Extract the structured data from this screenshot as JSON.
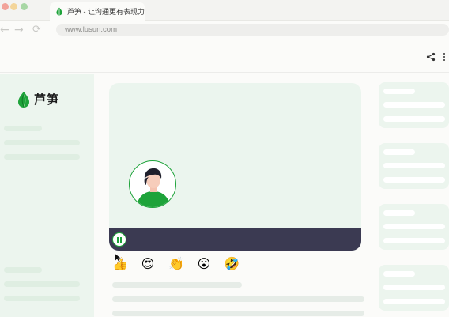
{
  "browser": {
    "tab_title": "芦笋 - 让沟通更有表现力",
    "url": "www.lusun.com",
    "nav": {
      "back": "←",
      "forward": "→",
      "reload": "⟳"
    }
  },
  "sidebar": {
    "logo_text": "芦笋"
  },
  "emojis": [
    {
      "name": "thumbs-up-emoji",
      "glyph": "👍"
    },
    {
      "name": "heart-eyes-emoji",
      "glyph": "😍"
    },
    {
      "name": "clapping-emoji",
      "glyph": "👏"
    },
    {
      "name": "surprised-emoji",
      "glyph": "😮"
    },
    {
      "name": "laughing-emoji",
      "glyph": "🤣"
    }
  ],
  "video": {
    "progress_fraction": 0.09,
    "state": "playing"
  },
  "colors": {
    "accent": "#1ea33a",
    "control_bar": "#3b3a52",
    "panel_bg": "#ecf5ee"
  },
  "icons": {
    "share": "share-icon",
    "more": "more-vertical-icon",
    "pause": "pause-icon",
    "logo": "asparagus-leaf-icon"
  }
}
